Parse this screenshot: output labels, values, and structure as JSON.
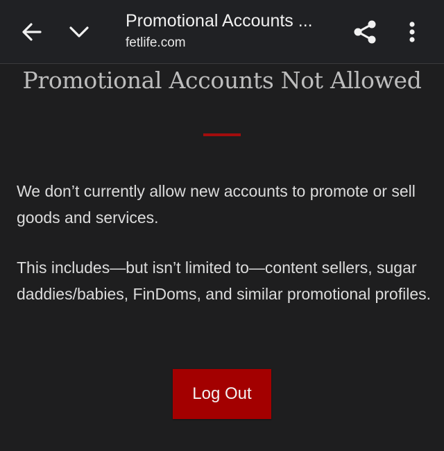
{
  "browser": {
    "tab_title": "Promotional Accounts ...",
    "url": "fetlife.com",
    "icons": [
      "back-arrow-icon",
      "chevron-down-icon",
      "share-icon",
      "more-vert-icon"
    ]
  },
  "page": {
    "heading": "Promotional Accounts Not Allowed",
    "paragraph1": "We don’t currently allow new accounts to promote or sell goods and services.",
    "paragraph2": "This includes—but isn’t limited to—content sellers, sugar daddies/babies, FinDoms, and similar promotional profiles.",
    "logout_label": "Log Out"
  },
  "colors": {
    "background": "#1e1e1f",
    "toolbar": "#202124",
    "accent": "#a30000",
    "heading": "#bdbdbd",
    "text": "#dcdcdc"
  }
}
